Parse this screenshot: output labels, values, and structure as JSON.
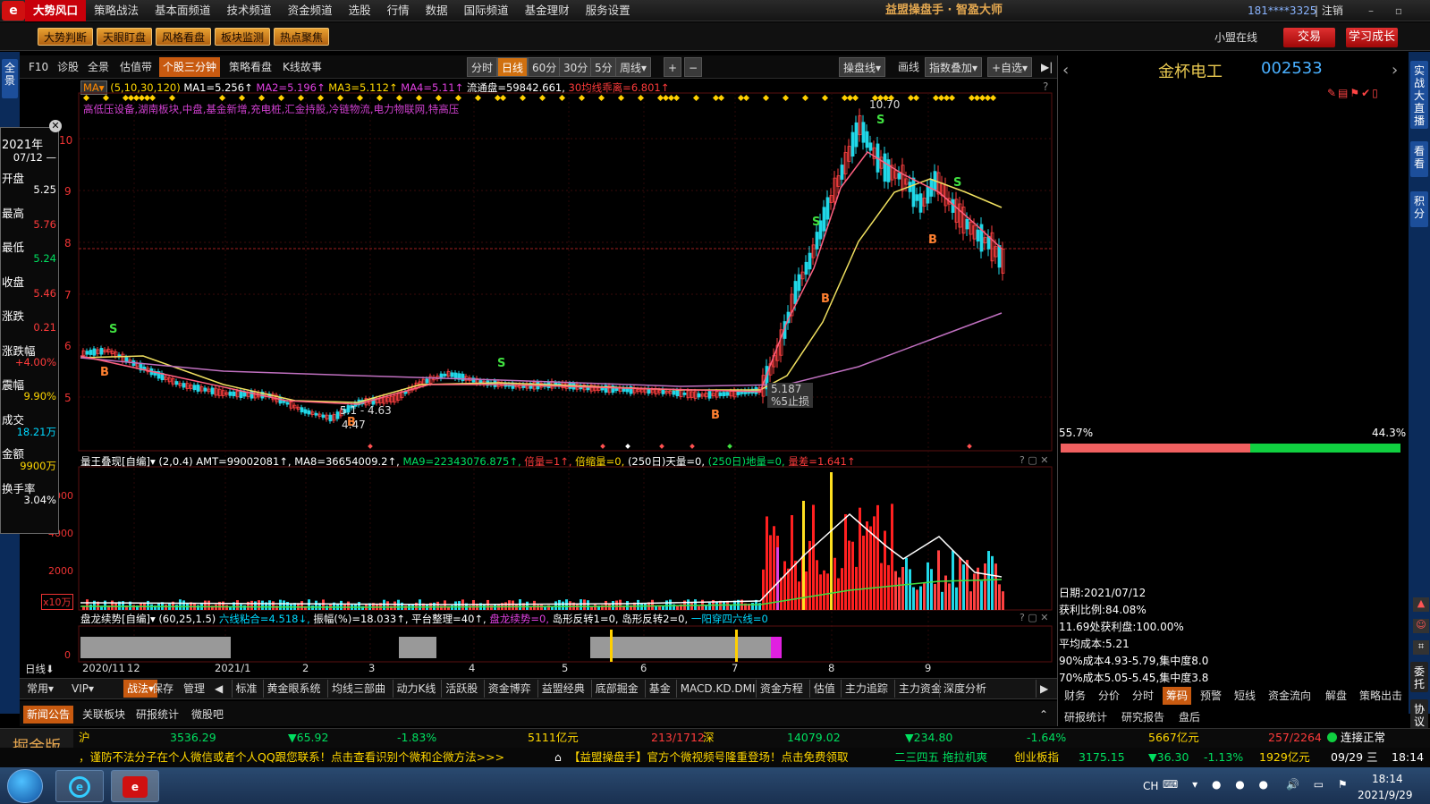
{
  "menu": {
    "logo": "e",
    "items": [
      "大势风口",
      "策略战法",
      "基本面频道",
      "技术频道",
      "资金频道",
      "选股",
      "行情",
      "数据",
      "国际频道",
      "基金理财",
      "服务设置"
    ],
    "app_title": "益盟操盘手 · 智盈大师",
    "account": "181****3325",
    "logout": "| 注销",
    "win_controls": "– ▫ ✕"
  },
  "toolbar": {
    "orange_buttons": [
      "大势判断",
      "天眼盯盘",
      "风格看盘",
      "板块监测",
      "热点聚焦"
    ],
    "online": "小盟在线",
    "trade": "交易",
    "learn": "学习成长"
  },
  "left_strip": {
    "quanjing": "全景",
    "top_label": "◤"
  },
  "right_strip": {
    "live": "实战大直播",
    "look": "看看",
    "points": "积分",
    "unit": "委托",
    "proto": "协议"
  },
  "chart_tabs": [
    "F10",
    "诊股",
    "全景",
    "估值带",
    "个股三分钟",
    "策略看盘",
    "K线故事"
  ],
  "period_tabs": [
    "分时",
    "日线",
    "60分",
    "30分",
    "5分",
    "周线▾"
  ],
  "zoom": [
    "+",
    "−"
  ],
  "right_tools": [
    "操盘线▾",
    "画线",
    "指数叠加▾",
    "+自选▾",
    "▶|"
  ],
  "ma_line": {
    "selector": "MA▾",
    "params": "(5,10,30,120)",
    "ma1": "MA1=5.256↑",
    "ma2": "MA2=5.196↑",
    "ma3": "MA3=5.112↑",
    "ma4": "MA4=5.11↑",
    "float": "流通盘=59842.661,",
    "dev": "30均线乖离=6.801↑",
    "q": "?"
  },
  "sectors": "高低压设备,湖南板块,中盘,基金新增,充电桩,汇金持股,冷链物流,电力物联网,特高压",
  "chart_labels": {
    "high": "10.70",
    "low_low": "4.47",
    "range": "5.1 - 4.63",
    "stop1": "5.187",
    "stop2": "%5止损",
    "s": "S",
    "b": "B"
  },
  "yaxis_main": [
    "10",
    "9",
    "8",
    "7",
    "6",
    "5"
  ],
  "vol_line": {
    "name": "量王叠现[自编]▾",
    "params": "(2,0.4)",
    "amt": "AMT=99002081↑,",
    "ma8": "MA8=36654009.2↑,",
    "ma9": "MA9=22343076.875↑,",
    "bei": "倍量=1↑,",
    "beisuo": "倍缩量=0,",
    "tian": "(250日)天量=0,",
    "di": "(250日)地量=0,",
    "liang": "量差=1.641↑",
    "ctrl": "? ▢ ✕"
  },
  "yaxis_vol": [
    "6000",
    "4000",
    "2000",
    "x10万"
  ],
  "pan_line": {
    "name": "盘龙续势[自编]▾",
    "params": "(60,25,1.5)",
    "lx": "六线粘合=4.518↓,",
    "zf": "振幅(%)=18.033↑,",
    "pt": "平台整理=40↑,",
    "pl": "盘龙续势=0,",
    "dao1": "岛形反转1=0,",
    "dao2": "岛形反转2=0,",
    "yy": "一阳穿四六线=0",
    "ctrl": "? ▢ ✕",
    "zero": "0"
  },
  "xaxis": {
    "day": "日线",
    "arrow": "⬇",
    "labels": [
      "2020/11",
      "12",
      "2021/1",
      "2",
      "3",
      "4",
      "5",
      "6",
      "7",
      "8",
      "9"
    ]
  },
  "bottom_tabs": {
    "left": [
      "常用▾",
      "VIP▾",
      "战法▾"
    ],
    "items": [
      "保存",
      "管理",
      "◀",
      "标准",
      "黄金眼系统",
      "均线三部曲",
      "动力K线",
      "活跃股",
      "资金博弈",
      "益盟经典",
      "底部掘金",
      "基金",
      "MACD.KD.DMI",
      "资金方程",
      "估值",
      "主力追踪",
      "主力资金",
      "深度分析",
      "▶"
    ]
  },
  "bottom2": [
    "新闻公告",
    "关联板块",
    "研报统计",
    "微股吧"
  ],
  "popup": {
    "year": "2021年",
    "date": "07/12 —",
    "rows": [
      {
        "label": "开盘",
        "value": "5.25",
        "cls": "wh"
      },
      {
        "label": "最高",
        "value": "5.76",
        "cls": "up"
      },
      {
        "label": "最低",
        "value": "5.24",
        "cls": "dn"
      },
      {
        "label": "收盘",
        "value": "5.46",
        "cls": "up"
      },
      {
        "label": "涨跌",
        "value": "0.21",
        "cls": "up"
      },
      {
        "label": "涨跌幅",
        "value": "+4.00%",
        "cls": "up"
      },
      {
        "label": "震幅",
        "value": "9.90%",
        "cls": "yl"
      },
      {
        "label": "成交",
        "value": "18.21万",
        "cls": "cy"
      },
      {
        "label": "金额",
        "value": "9900万",
        "cls": "yl"
      },
      {
        "label": "换手率",
        "value": "3.04%",
        "cls": "wh"
      }
    ],
    "close": "✕"
  },
  "right_panel": {
    "name": "金杯电工",
    "code": "002533",
    "prev": "‹",
    "next": "›",
    "pct_left": "55.7%",
    "pct_right": "44.3%",
    "info": [
      "日期:2021/07/12",
      "获利比例:84.08%",
      "11.69处获利盘:100.00%",
      "平均成本:5.21",
      "90%成本4.93-5.79,集中度8.0",
      "70%成本5.05-5.45,集中度3.8"
    ],
    "tabs1": [
      "财务",
      "分价",
      "分时",
      "筹码",
      "预警",
      "短线",
      "资金流向",
      "解盘",
      "策略出击"
    ],
    "tabs2": [
      "研报统计",
      "研究报告",
      "盘后"
    ]
  },
  "ticker": {
    "jj": "掘金版",
    "sh": "沪",
    "sh_idx": "3536.29",
    "sh_chg": "▼65.92",
    "sh_pct": "-1.83%",
    "sh_amt": "5111亿元",
    "sh_ud": "213/1712",
    "sz": "深",
    "sz_idx": "14079.02",
    "sz_chg": "▼234.80",
    "sz_pct": "-1.64%",
    "sz_amt": "5667亿元",
    "sz_ud": "257/2264",
    "conn": "连接正常",
    "scroll1": "，谨防不法分子在个人微信或者个人QQ跟您联系！点击查看识别个微和企微方法>>>",
    "scroll2": "【益盟操盘手】官方个微视频号隆重登场！点击免费领取",
    "scroll3": "二三四五 拖拉机爽",
    "cyb": "创业板指",
    "cyb_idx": "3175.15",
    "cyb_chg": "▼36.30",
    "cyb_pct": "-1.13%",
    "cyb_amt": "1929亿元",
    "date": "09/29 三",
    "time": "18:14"
  },
  "taskbar": {
    "ch": "CH",
    "time": "18:14",
    "date": "2021/9/29"
  },
  "colors": {
    "up": "#ff3b3b",
    "down": "#00e060",
    "yellow": "#ffd700",
    "accent": "#c8000a"
  }
}
